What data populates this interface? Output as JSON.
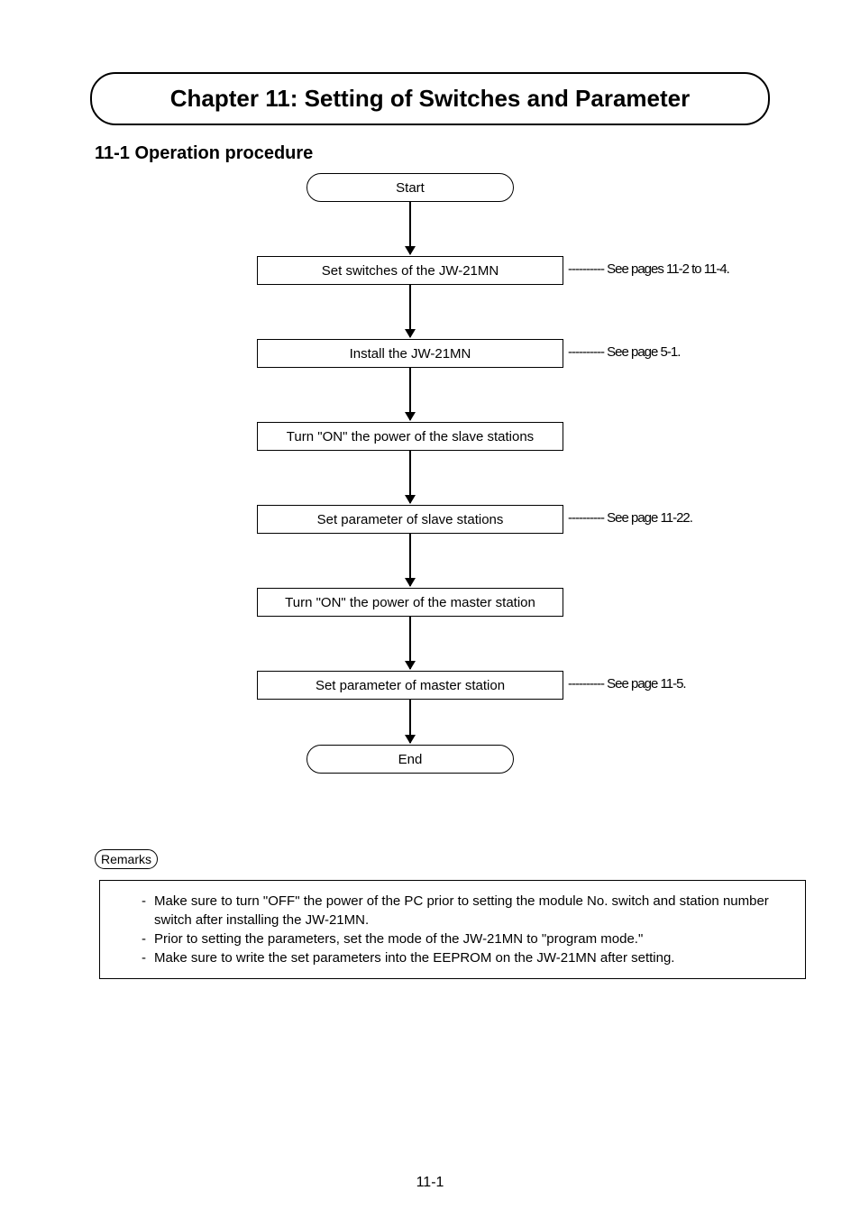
{
  "chapter_title": "Chapter 11: Setting of Switches and Parameter",
  "section_title": "11-1 Operation procedure",
  "flow": {
    "start": "Start",
    "step1": "Set switches of the JW-21MN",
    "anno1": "---------- See pages 11-2 to 11-4.",
    "step2": "Install the JW-21MN",
    "anno2": "---------- See page 5-1.",
    "step3": "Turn \"ON\" the power of the slave stations",
    "step4": "Set parameter of slave stations",
    "anno4": "---------- See page 11-22.",
    "step5": "Turn \"ON\" the power of the master station",
    "step6": "Set parameter of master station",
    "anno6": "---------- See page 11-5.",
    "end": "End"
  },
  "remarks_label": "Remarks",
  "remarks": {
    "item1": "Make sure to turn \"OFF\" the power of the PC prior to setting the module No. switch and station number switch after installing the JW-21MN.",
    "item2": "Prior to setting the parameters, set the mode of the JW-21MN to \"program mode.\"",
    "item3": "Make sure to write the set parameters into the EEPROM on the JW-21MN after setting."
  },
  "page_number": "11-1"
}
